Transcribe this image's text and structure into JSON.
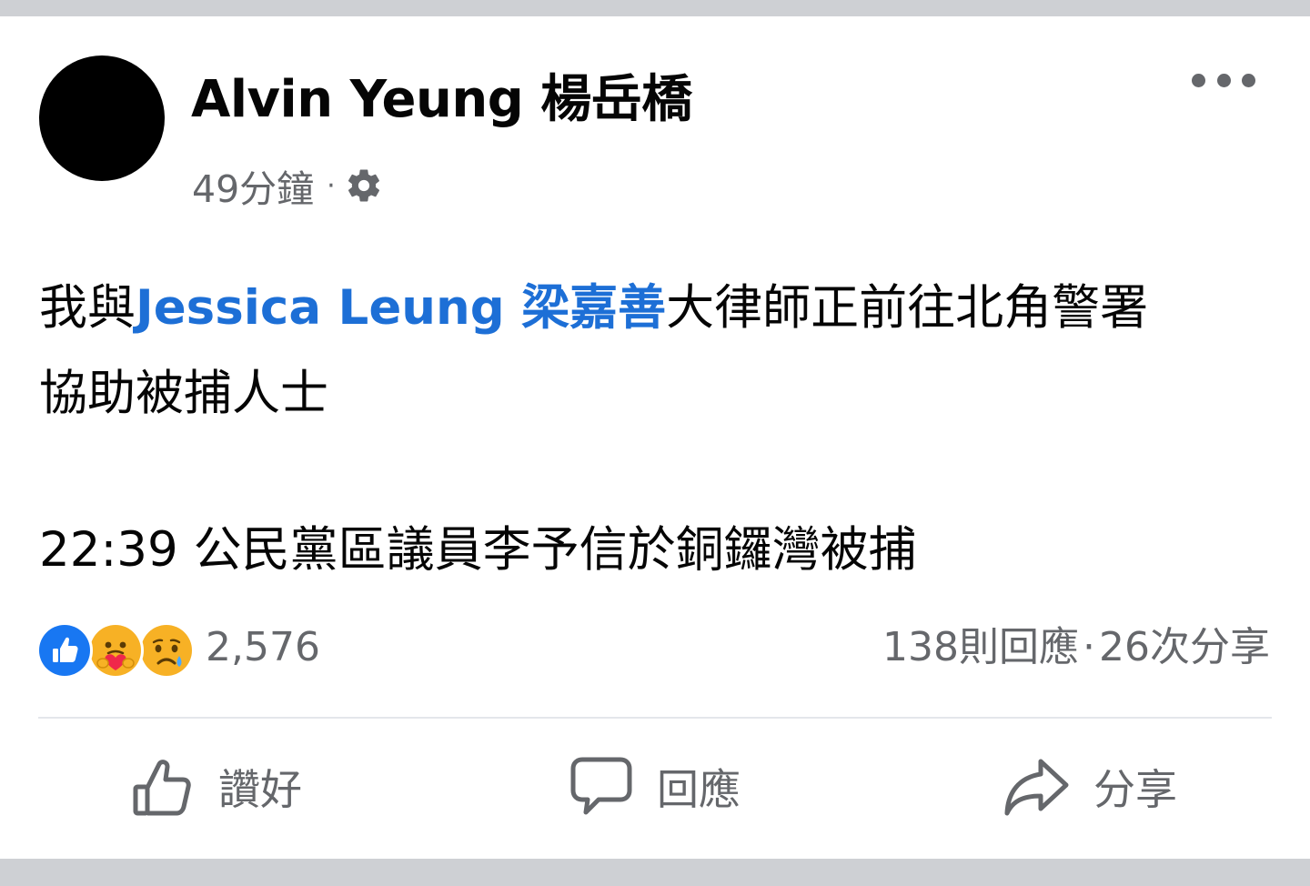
{
  "post": {
    "author": "Alvin Yeung 楊岳橋",
    "time": "49分鐘",
    "separator": "·",
    "privacy_icon": "gear-icon",
    "text_line1_prefix": "我與",
    "mention": "Jessica Leung 梁嘉善",
    "text_line1_suffix": "大律師正前往北角警署",
    "text_line2": "協助被捕人士",
    "text_line3": "22:39 公民黨區議員李予信於銅鑼灣被捕"
  },
  "reactions": {
    "icons": [
      "like-icon",
      "care-icon",
      "sad-icon"
    ],
    "count": "2,576",
    "comments": "138則回應",
    "separator": "·",
    "shares": "26次分享"
  },
  "actions": {
    "like_label": "讚好",
    "comment_label": "回應",
    "share_label": "分享"
  },
  "colors": {
    "mention": "#1d6fd6",
    "secondary_text": "#65676b",
    "like_blue": "#1877f2",
    "frame_gray": "#ced0d4"
  }
}
